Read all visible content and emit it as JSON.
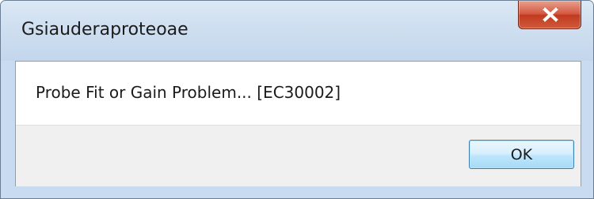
{
  "window": {
    "title": "Gsiauderaproteoae",
    "close_icon": "close-x-icon"
  },
  "dialog": {
    "message": "Probe Fit or Gain Problem... [EC30002]",
    "ok_label": "OK"
  },
  "colors": {
    "frame": "#c9dcef",
    "close_button": "#c23a20",
    "content_bg": "#ffffff",
    "footer_bg": "#f0f0f0",
    "ok_button_border": "#3c7fb1"
  }
}
